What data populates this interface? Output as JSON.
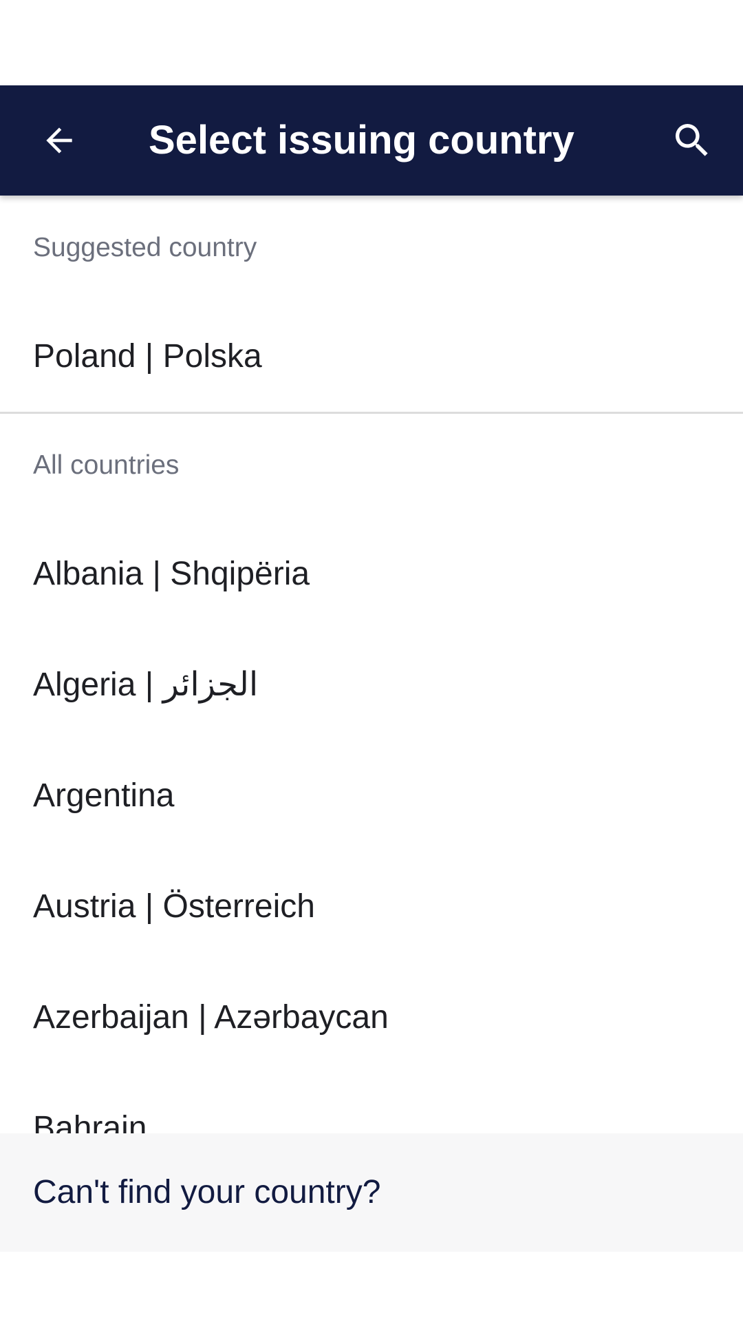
{
  "header": {
    "title": "Select issuing country",
    "back_icon": "arrow-back-icon",
    "search_icon": "search-icon"
  },
  "suggested": {
    "heading": "Suggested country",
    "items": [
      {
        "label": "Poland | Polska"
      }
    ]
  },
  "all": {
    "heading": "All countries",
    "items": [
      {
        "label": "Albania | Shqipëria"
      },
      {
        "label": "Algeria | الجزائر"
      },
      {
        "label": "Argentina"
      },
      {
        "label": "Austria | Österreich"
      },
      {
        "label": "Azerbaijan | Azərbaycan"
      },
      {
        "label": "Bahrain"
      }
    ]
  },
  "footer": {
    "link_label": "Can't find your country?"
  },
  "colors": {
    "app_bar": "#121b41",
    "footer_link": "#121b41",
    "section_header": "#6b6f7c"
  }
}
